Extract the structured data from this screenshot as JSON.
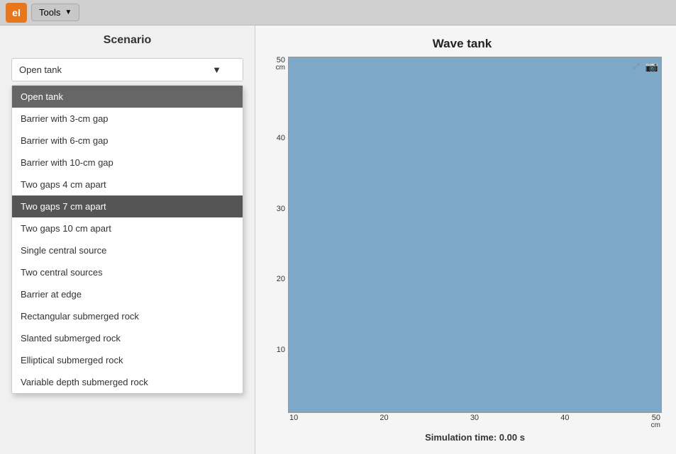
{
  "topbar": {
    "logo_label": "el",
    "tools_label": "Tools"
  },
  "left_panel": {
    "scenario_title": "Scenario",
    "selected_value": "Open tank",
    "dropdown_items": [
      {
        "label": "Open tank",
        "state": "selected"
      },
      {
        "label": "Barrier with 3-cm gap",
        "state": "normal"
      },
      {
        "label": "Barrier with 6-cm gap",
        "state": "normal"
      },
      {
        "label": "Barrier with 10-cm gap",
        "state": "normal"
      },
      {
        "label": "Two gaps 4 cm apart",
        "state": "normal"
      },
      {
        "label": "Two gaps 7 cm apart",
        "state": "highlighted"
      },
      {
        "label": "Two gaps 10 cm apart",
        "state": "normal"
      },
      {
        "label": "Single central source",
        "state": "normal"
      },
      {
        "label": "Two central sources",
        "state": "normal"
      },
      {
        "label": "Barrier at edge",
        "state": "normal"
      },
      {
        "label": "Rectangular submerged rock",
        "state": "normal"
      },
      {
        "label": "Slanted submerged rock",
        "state": "normal"
      },
      {
        "label": "Elliptical submerged rock",
        "state": "normal"
      },
      {
        "label": "Variable depth submerged rock",
        "state": "normal"
      }
    ]
  },
  "chart": {
    "title": "Wave tank",
    "y_axis": {
      "top_value": "50",
      "top_unit": "cm",
      "ticks": [
        "40",
        "30",
        "20",
        "10"
      ]
    },
    "x_axis": {
      "ticks": [
        "10",
        "20",
        "30",
        "40",
        "50"
      ],
      "unit": "cm"
    },
    "simulation_time_label": "Simulation time: 0.00 s",
    "tank_color": "#7da8c7"
  }
}
